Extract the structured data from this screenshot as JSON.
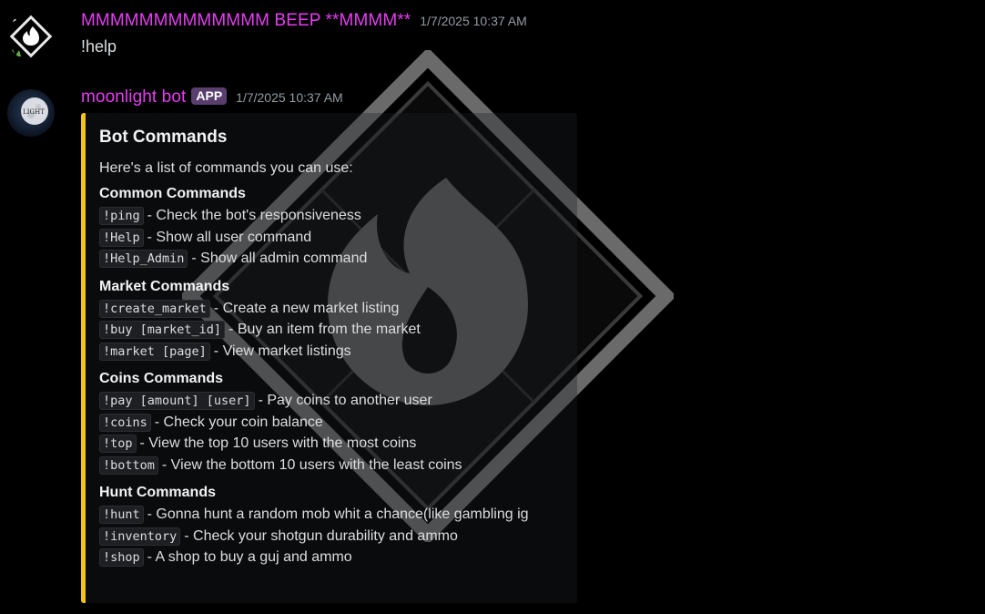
{
  "messages": {
    "user": {
      "username": "MMMMMMMMMMMMM BEEP **MMMM**",
      "timestamp": "1/7/2025 10:37 AM",
      "content": "!help",
      "avatar_icon": "flame-diamond-avatar"
    },
    "bot": {
      "username": "moonlight bot",
      "badge": "APP",
      "timestamp": "1/7/2025 10:37 AM",
      "avatar_icon": "moon-avatar",
      "avatar_text": "LIGHT",
      "embed": {
        "accent_color": "#f0c419",
        "title": "Bot Commands",
        "description": "Here's a list of commands you can use:",
        "sections": [
          {
            "title": "Common Commands",
            "commands": [
              {
                "code": "!ping",
                "desc": "- Check the bot's responsiveness"
              },
              {
                "code": "!Help",
                "desc": "- Show all user command"
              },
              {
                "code": "!Help_Admin",
                "desc": "- Show all admin command"
              }
            ]
          },
          {
            "title": "Market Commands",
            "commands": [
              {
                "code": "!create_market",
                "desc": "- Create a new market listing"
              },
              {
                "code": "!buy [market_id]",
                "desc": "- Buy an item from the market"
              },
              {
                "code": "!market [page]",
                "desc": "- View market listings"
              }
            ]
          },
          {
            "title": "Coins Commands",
            "commands": [
              {
                "code": "!pay [amount] [user]",
                "desc": "- Pay coins to another user"
              },
              {
                "code": "!coins",
                "desc": "- Check your coin balance"
              },
              {
                "code": "!top",
                "desc": "- View the top 10 users with the most coins"
              },
              {
                "code": "!bottom",
                "desc": "- View the bottom 10 users with the least coins"
              }
            ]
          },
          {
            "title": "Hunt Commands",
            "commands": [
              {
                "code": "!hunt",
                "desc": "- Gonna hunt a random mob whit a chance(like gambling ig"
              },
              {
                "code": "!inventory",
                "desc": "- Check your shotgun durability and ammo"
              },
              {
                "code": "!shop",
                "desc": "- A shop to buy a guj and ammo"
              }
            ]
          }
        ]
      }
    }
  },
  "colors": {
    "background": "#000000",
    "username": "#e53ef0",
    "badge_bg": "#5a3e6e",
    "timestamp": "#949ba4",
    "text": "#dbdee1",
    "embed_accent": "#f0c419"
  },
  "watermark_icon": "flame-diamond-watermark"
}
